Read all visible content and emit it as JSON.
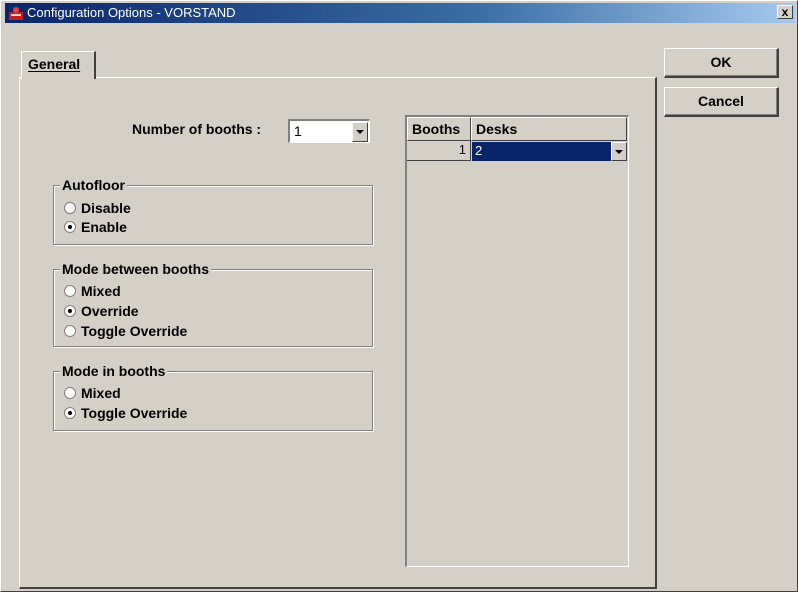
{
  "window": {
    "title": "Configuration Options - VORSTAND",
    "close_label": "x"
  },
  "buttons": {
    "ok": "OK",
    "cancel": "Cancel"
  },
  "tabs": [
    {
      "label": "General",
      "selected": true
    }
  ],
  "general": {
    "booths_label": "Number of booths :",
    "booths_value": "1",
    "autofloor": {
      "title": "Autofloor",
      "options": [
        {
          "label": "Disable",
          "checked": false
        },
        {
          "label": "Enable",
          "checked": true
        }
      ]
    },
    "mode_between": {
      "title": "Mode between booths",
      "options": [
        {
          "label": "Mixed",
          "checked": false
        },
        {
          "label": "Override",
          "checked": true
        },
        {
          "label": "Toggle Override",
          "checked": false
        }
      ]
    },
    "mode_in": {
      "title": "Mode in booths",
      "options": [
        {
          "label": "Mixed",
          "checked": false
        },
        {
          "label": "Toggle Override",
          "checked": true
        }
      ]
    },
    "grid": {
      "columns": [
        "Booths",
        "Desks"
      ],
      "rows": [
        {
          "booth": "1",
          "desks": "2"
        }
      ]
    }
  },
  "colors": {
    "titlebar": "#0a246a",
    "face": "#d4d0c8",
    "selection": "#0a246a"
  },
  "icons": {
    "app": "conference-icon",
    "dropdown": "chevron-down-icon"
  }
}
